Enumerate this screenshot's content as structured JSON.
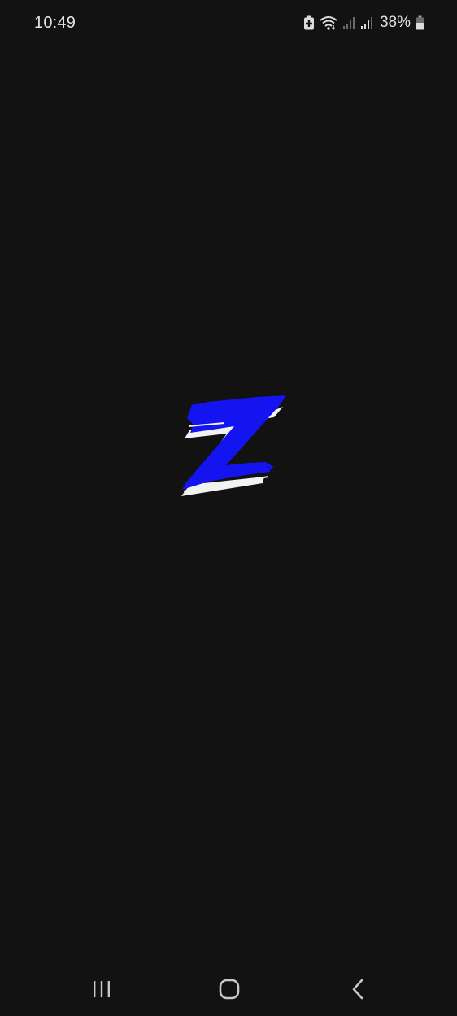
{
  "status_bar": {
    "time": "10:49",
    "battery_percent": "38%",
    "icons": [
      "battery-saver-icon",
      "wifi-icon",
      "signal-sim1-icon",
      "signal-sim2-icon",
      "battery-icon"
    ]
  },
  "splash": {
    "logo_text": "Z",
    "logo_color": "#1414f0"
  },
  "nav_bar": {
    "icons": [
      "recents-icon",
      "home-icon",
      "back-icon"
    ]
  },
  "colors": {
    "background": "#121212",
    "status_text": "#e3e3e3"
  }
}
